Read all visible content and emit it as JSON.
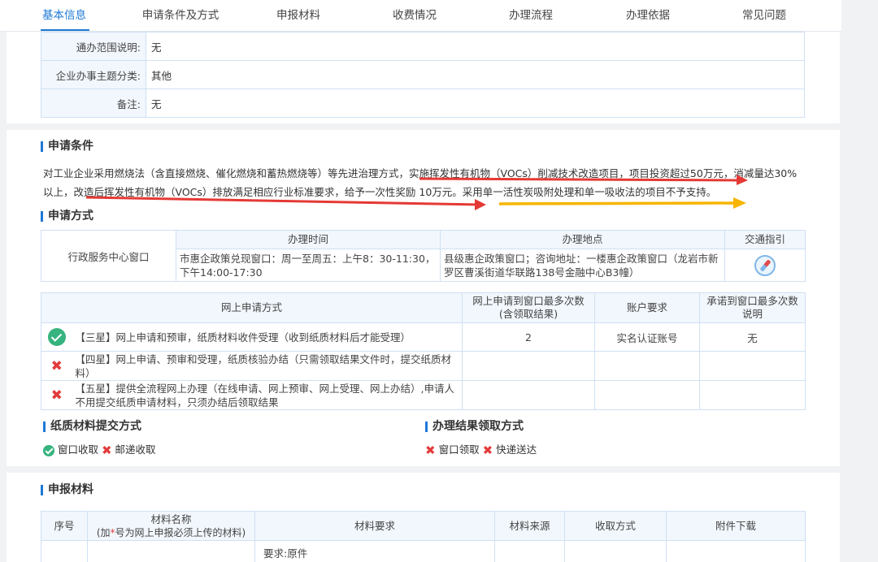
{
  "tabs": [
    {
      "label": "基本信息"
    },
    {
      "label": "申请条件及方式"
    },
    {
      "label": "申报材料"
    },
    {
      "label": "收费情况"
    },
    {
      "label": "办理流程"
    },
    {
      "label": "办理依据"
    },
    {
      "label": "常见问题"
    }
  ],
  "basic_info": {
    "rows": [
      {
        "label": "通办范围说明:",
        "value": "无"
      },
      {
        "label": "企业办事主题分类:",
        "value": "其他"
      },
      {
        "label": "备注:",
        "value": "无"
      }
    ]
  },
  "conditions": {
    "title": "申请条件",
    "text": "对工业企业采用燃烧法（含直接燃烧、催化燃烧和蓄热燃烧等）等先进治理方式，实施挥发性有机物（VOCs）削减技术改造项目，项目投资超过50万元，消减量达30%以上，改造后挥发性有机物（VOCs）排放满足相应行业标准要求，给予一次性奖励 10万元。采用单一活性炭吸附处理和单一吸收法的项目不予支持。"
  },
  "apply_method": {
    "title": "申请方式",
    "window_table": {
      "channel": "行政服务中心窗口",
      "headers": {
        "time": "办理时间",
        "place": "办理地点",
        "traffic": "交通指引"
      },
      "time": "市惠企政策兑现窗口：周一至周五：上午8：30-11:30，下午14:00-17:30",
      "place": "县级惠企政策窗口；咨询地址：一楼惠企政策窗口（龙岩市新罗区曹溪街道华联路138号金融中心B3幢）",
      "traffic_icon": "compass-icon"
    },
    "online_table": {
      "headers": {
        "method": "网上申请方式",
        "max_visits": "网上申请到窗口最多次数(含领取结果)",
        "account": "账户要求",
        "promise": "承诺到窗口最多次数说明"
      },
      "rows": [
        {
          "status": "ok",
          "text": "【三星】网上申请和预审，纸质材料收件受理（收到纸质材料后才能受理）",
          "max_visits": "2",
          "account": "实名认证账号",
          "promise": "无"
        },
        {
          "status": "no",
          "text": "【四星】网上申请、预审和受理，纸质核验办结（只需领取结果文件时，提交纸质材料）",
          "max_visits": "",
          "account": "",
          "promise": ""
        },
        {
          "status": "no",
          "text": "【五星】提供全流程网上办理（在线申请、网上预审、网上受理、网上办结）,申请人不用提交纸质申请材料，只须办结后领取结果",
          "max_visits": "",
          "account": "",
          "promise": ""
        }
      ]
    }
  },
  "paper_submit": {
    "title": "纸质材料提交方式",
    "items": [
      {
        "status": "ok",
        "label": "窗口收取"
      },
      {
        "status": "no",
        "label": "邮递收取"
      }
    ]
  },
  "result_receive": {
    "title": "办理结果领取方式",
    "items": [
      {
        "status": "no",
        "label": "窗口领取"
      },
      {
        "status": "no",
        "label": "快递送达"
      }
    ]
  },
  "materials": {
    "title": "申报材料",
    "headers": {
      "index": "序号",
      "name": "材料名称",
      "name_note_prefix": "(加",
      "name_note_star": "*",
      "name_note_suffix": "号为网上申报必须上传的材料)",
      "requirement": "材料要求",
      "source": "材料来源",
      "receive": "收取方式",
      "attachment": "附件下载"
    },
    "first_row": {
      "requirement": "要求:原件"
    }
  },
  "colors": {
    "accent": "#1e78d6",
    "border": "#cfe0f3",
    "header_bg": "#f2f7fd",
    "ok": "#36b37e",
    "no": "#e23b3b",
    "underline_red": "#e53935",
    "underline_orange": "#f7b500"
  }
}
